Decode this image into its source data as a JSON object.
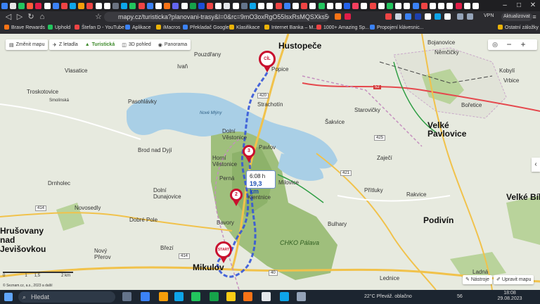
{
  "browser": {
    "tab_colors": [
      "#3b82f6",
      "#e6e6e6",
      "#22c55e",
      "#ff5a3c",
      "#e11d48",
      "#ffffff",
      "#3b82f6",
      "#ef4444",
      "#0ea5e9",
      "#f59e0b",
      "#ef4444",
      "#ffffff",
      "#ffffff",
      "#6b7280",
      "#0ea5e9",
      "#22c55e",
      "#ef4444",
      "#3b82f6",
      "#ffffff",
      "#f97316",
      "#6366f1",
      "#ffffff",
      "#16a34a",
      "#1d4ed8",
      "#ef4444",
      "#ffffff",
      "#e5e7eb",
      "#ffffff",
      "#64748b",
      "#0ea5e9",
      "#ffffff",
      "#ffffff",
      "#ef4444",
      "#3b82f6",
      "#ffffff",
      "#ef4444",
      "#ffffff",
      "#22c55e",
      "#ffffff",
      "#ffffff",
      "#2563eb",
      "#f43f5e",
      "#ffffff",
      "#ef4444",
      "#ffffff",
      "#22c55e",
      "#ffffff",
      "#ffffff",
      "#3b82f6",
      "#ef4444",
      "#ffffff",
      "#ffffff",
      "#ffffff",
      "#e11d48",
      "#ffffff",
      "#ffffff",
      "#ffffff",
      "#ffffff",
      "#ffffff",
      "#ffffff",
      "#ffffff",
      "#ffffff",
      "#ffffff",
      "#ffffff",
      "#ffffff",
      "#ffffff",
      "#ffffff",
      "#ffffff",
      "#ffffff",
      "#ffffff",
      "#ffffff",
      "#ffffff",
      "#ffffff",
      "#ffffff",
      "#ffffff",
      "#ffffff",
      "#ffffff",
      "#ffffff",
      "#ffffff",
      "#ffffff",
      "#ffffff",
      "#ffffff",
      "#ffffff",
      "#ffffff",
      "#ffffff",
      "#ffffff",
      "#ffffff",
      "#ffffff",
      "#ffffff",
      "#ffffff",
      "#ffffff",
      "#ffffff",
      "#ffffff",
      "#ffffff",
      "#ffffff",
      "#ffffff",
      "#ffffff",
      "#ffffff",
      "#ffffff",
      "#ffffff",
      "#ffffff",
      "#ffffff",
      "#ffffff",
      "#ffffff",
      "#ffffff",
      "#ffffff",
      "#ffffff",
      "#ffffff",
      "#ffffff",
      "#ffffff",
      "#ffffff",
      "#ffffff",
      "#ffffff",
      "#ffffff",
      "#ffffff",
      "#ffffff",
      "#ffffff",
      "#ffffff",
      "#ffffff",
      "#ffffff",
      "#ffffff",
      "#ffffff",
      "#ffffff",
      "#ffffff",
      "#ffffff",
      "#ffffff",
      "#ffffff",
      "#ffffff",
      "#ffffff",
      "#ffffff",
      "#ffffff",
      "#ffffff",
      "#ffffff",
      "#ffffff",
      "#ffffff",
      "#ffffff",
      "#ffffff",
      "#ffffff",
      "#ffffff",
      "#ffffff",
      "#ffffff",
      "#ffffff",
      "#ffffff",
      "#ffffff",
      "#ffffff",
      "#ffffff",
      "#ffffff",
      "#ffffff",
      "#ffffff",
      "#ffffff",
      "#ffffff",
      "#ffffff"
    ],
    "url": "mapy.cz/turisticka?planovani-trasy&l=0&rc=9mO3oxRgO55lsxRsMQSXks50-jiGYsQ79...",
    "vpn": "VPN",
    "update_label": "Aktualizovat",
    "bookmarks": [
      "Brave Rewards",
      "Uphold",
      "Štefan D - YouTube",
      "Aplikace",
      "iMacros",
      "Překladač Google",
      "Klasifikace",
      "Internet Banka – M...",
      "1000+ Amazing Sp...",
      "Propojení klávesnic..."
    ],
    "bookmarks_other": "Ostatní záložky"
  },
  "map": {
    "toolbar": {
      "change_map": "Změnit mapu",
      "aerial": "Z letadla",
      "tourist": "Turistická",
      "view3d": "3D pohled",
      "panorama": "Panorama"
    },
    "towns": [
      "Hustopeče",
      "Velké Pavlovice",
      "Podivín",
      "Mikulov",
      "Velké Bílo",
      "Hrušovany nad Jevišovkou"
    ],
    "places": [
      "Pouzdřany",
      "Popice",
      "Strachotín",
      "Šakvice",
      "Starovičky",
      "Dolní Věstonice",
      "Pavlov",
      "Horní Věstonice",
      "Perná",
      "Milovice",
      "Klentnice",
      "Bavory",
      "Brod nad Dyjí",
      "Dolní Dunajovice",
      "Drnholec",
      "Novosedly",
      "Dobré Pole",
      "Nový Přerov",
      "Březí",
      "Pasohlávky",
      "Troskotovice",
      "Ivaň",
      "Vlasatice",
      "Přítluky",
      "Rakvice",
      "Zaječí",
      "Bulhary",
      "Lednice",
      "Bořetice",
      "Němčičky",
      "Bojanovice",
      "Kobylí",
      "Vrbice",
      "Smolínská",
      "Nové Mlýny",
      "CHKO Pálava",
      "Ladná",
      "Podivín",
      "Drnholec"
    ],
    "ridge_label": "CHKO Pálava",
    "route": {
      "time": "6:08 h",
      "distance": "19,3 km"
    },
    "pins": {
      "start": "START",
      "end": "CÍL",
      "p2": "2",
      "p3": "3"
    },
    "zoom_in": "+",
    "zoom_out": "−",
    "tools": "Nástroje",
    "edit_map": "Upravit mapu",
    "scale_ticks": [
      "0",
      "1",
      "1,5",
      "2 km"
    ],
    "copyright": "© Seznam.cz, a.s., 2023 a další",
    "road_numbers": [
      "420",
      "52",
      "425",
      "421",
      "414",
      "40",
      "414"
    ]
  },
  "taskbar": {
    "search_placeholder": "Hledat",
    "weather": "22°C  Převáž. oblačno",
    "tray_count": "56",
    "time": "18:08",
    "date": "29.08.2023"
  }
}
